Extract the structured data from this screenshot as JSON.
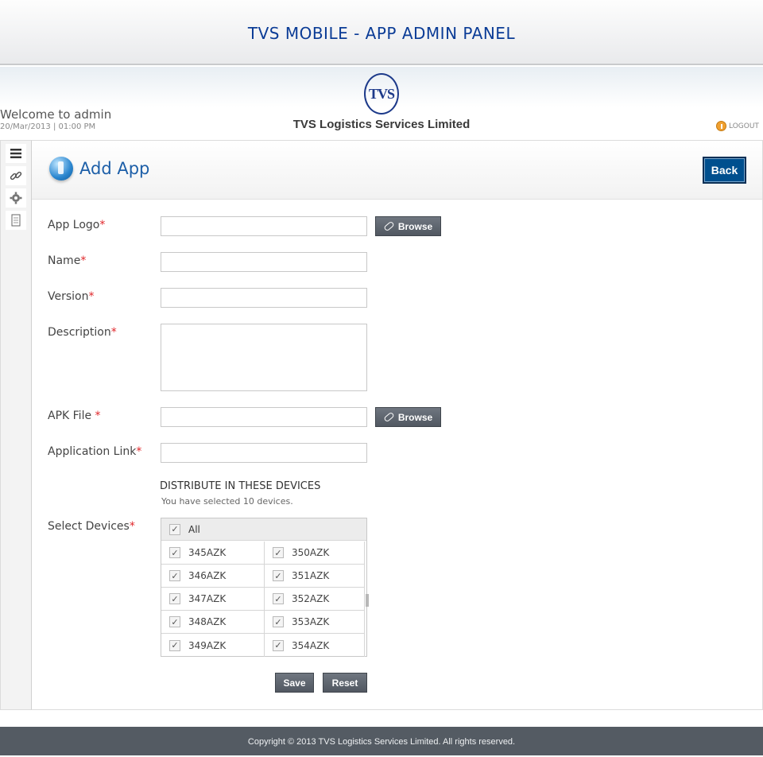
{
  "header": {
    "title": "TVS MOBILE - APP ADMIN PANEL",
    "logo_text": "TVS",
    "company": "TVS Logistics Services Limited",
    "welcome": "Welcome to admin",
    "datetime": "20/Mar/2013 | 01:00 PM",
    "logout": "LOGOUT"
  },
  "sidebar": {
    "icons": [
      "menu-icon",
      "link-icon",
      "gear-icon",
      "document-icon"
    ]
  },
  "page": {
    "title": "Add App",
    "back_label": "Back"
  },
  "form": {
    "required_mark": "*",
    "app_logo_label": "App Logo",
    "name_label": "Name",
    "version_label": "Version",
    "description_label": "Description",
    "apk_file_label": "APK File ",
    "app_link_label": "Application Link",
    "browse_label": "Browse",
    "distribute_title": "DISTRIBUTE IN THESE DEVICES",
    "distribute_sub": "You have selected 10 devices.",
    "select_devices_label": "Select Devices",
    "all_label": "All",
    "devices": [
      [
        "345AZK",
        "350AZK"
      ],
      [
        "346AZK",
        "351AZK"
      ],
      [
        "347AZK",
        "352AZK"
      ],
      [
        "348AZK",
        "353AZK"
      ],
      [
        "349AZK",
        "354AZK"
      ]
    ],
    "save_label": "Save",
    "reset_label": "Reset"
  },
  "colors": {
    "title_blue": "#0b3c96",
    "accent_blue": "#1d5fa8",
    "back_button": "#004f8e",
    "required": "#e0262a",
    "button_gray": "#5e656e",
    "footer": "#545b63"
  },
  "footer": {
    "copyright": "Copyright © 2013 TVS Logistics Services Limited. All rights reserved."
  }
}
